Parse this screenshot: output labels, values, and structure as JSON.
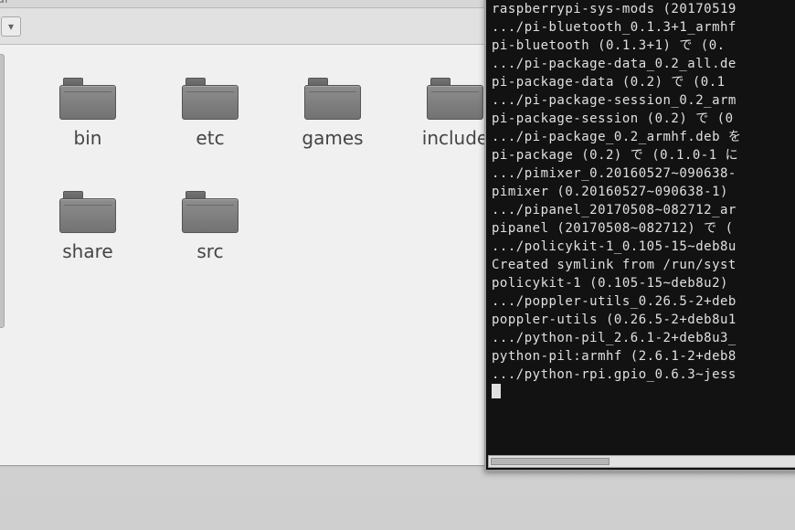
{
  "file_manager": {
    "title_fragment": "al",
    "folders": [
      {
        "name": "bin"
      },
      {
        "name": "etc"
      },
      {
        "name": "games"
      },
      {
        "name": "include"
      },
      {
        "name": "share"
      },
      {
        "name": "src"
      }
    ]
  },
  "terminal": {
    "lines": [
      "raspberrypi-sys-mods (20170519",
      ".../pi-bluetooth_0.1.3+1_armhf",
      "pi-bluetooth (0.1.3+1) で (0.",
      ".../pi-package-data_0.2_all.de",
      "pi-package-data (0.2) で (0.1",
      ".../pi-package-session_0.2_arm",
      "pi-package-session (0.2) で (0",
      ".../pi-package_0.2_armhf.deb を",
      "pi-package (0.2) で (0.1.0-1 に",
      ".../pimixer_0.20160527~090638-",
      "pimixer (0.20160527~090638-1)",
      "",
      ".../pipanel_20170508~082712_ar",
      "pipanel (20170508~082712) で (",
      ".../policykit-1_0.105-15~deb8u",
      "Created symlink from /run/syst",
      "policykit-1 (0.105-15~deb8u2)",
      ".../poppler-utils_0.26.5-2+deb",
      "poppler-utils (0.26.5-2+deb8u1",
      ".../python-pil_2.6.1-2+deb8u3_",
      "python-pil:armhf (2.6.1-2+deb8",
      "",
      ".../python-rpi.gpio_0.6.3~jess"
    ]
  }
}
